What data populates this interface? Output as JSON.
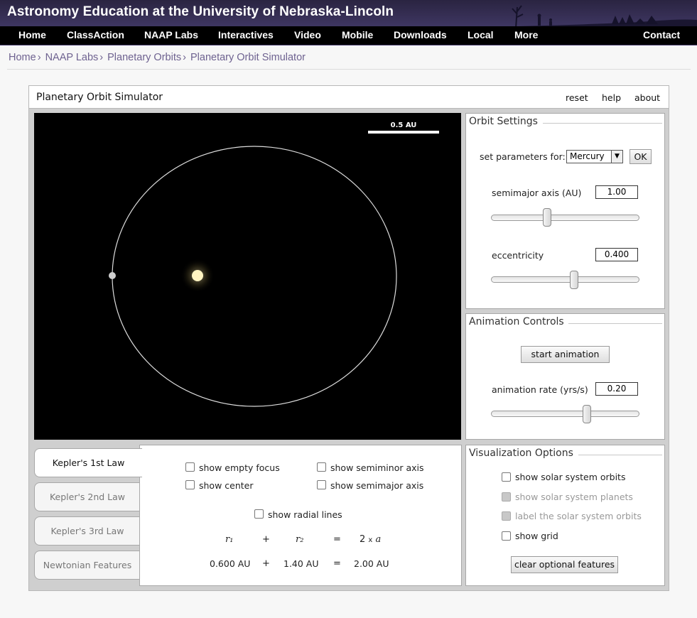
{
  "site": {
    "title": "Astronomy Education at the University of Nebraska-Lincoln",
    "nav": [
      "Home",
      "ClassAction",
      "NAAP Labs",
      "Interactives",
      "Video",
      "Mobile",
      "Downloads",
      "Local",
      "More",
      "Contact"
    ]
  },
  "breadcrumb": [
    "Home",
    "NAAP Labs",
    "Planetary Orbits",
    "Planetary Orbit Simulator"
  ],
  "sim": {
    "title": "Planetary Orbit Simulator",
    "links": [
      "reset",
      "help",
      "about"
    ]
  },
  "canvas": {
    "scale_label": "0.5 AU"
  },
  "orbit_settings": {
    "legend": "Orbit Settings",
    "set_params_label": "set parameters for:",
    "planet_selected": "Mercury",
    "ok_label": "OK",
    "semimajor_label": "semimajor axis (AU)",
    "semimajor_value": "1.00",
    "eccentricity_label": "eccentricity",
    "eccentricity_value": "0.400"
  },
  "animation_controls": {
    "legend": "Animation Controls",
    "start_label": "start animation",
    "rate_label": "animation rate (yrs/s)",
    "rate_value": "0.20"
  },
  "visualization": {
    "legend": "Visualization Options",
    "options": [
      {
        "label": "show solar system orbits",
        "enabled": true
      },
      {
        "label": "show solar system planets",
        "enabled": false
      },
      {
        "label": "label the solar system orbits",
        "enabled": false
      },
      {
        "label": "show grid",
        "enabled": true
      }
    ],
    "clear_label": "clear optional features"
  },
  "tabs": [
    "Kepler's 1st Law",
    "Kepler's 2nd Law",
    "Kepler's 3rd Law",
    "Newtonian Features"
  ],
  "kepler1": {
    "checkboxes": [
      "show empty focus",
      "show center",
      "show semiminor axis",
      "show semimajor axis",
      "show radial lines"
    ],
    "eq_r1": "r₁",
    "eq_plus": "+",
    "eq_r2": "r₂",
    "eq_equals": "=",
    "eq_2": "2",
    "eq_times": "x",
    "eq_a": "a",
    "val_r1": "0.600 AU",
    "val_r2": "1.40 AU",
    "val_sum": "2.00 AU"
  },
  "colors": {
    "header_bg": "#3d3560",
    "link_purple": "#6e6290",
    "orbit_line": "#dddddd",
    "sun": "#fff4c2"
  }
}
